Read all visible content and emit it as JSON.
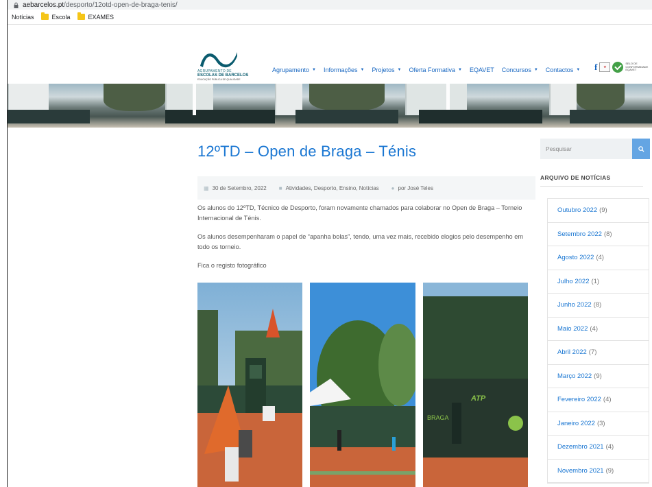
{
  "browser": {
    "url_host": "aebarcelos.pt",
    "url_path": "/desporto/12otd-open-de-braga-tenis/",
    "bookmarks": [
      "Notícias",
      "Escola",
      "EXAMES"
    ]
  },
  "logo": {
    "line1": "AGRUPAMENTO DE",
    "line2": "ESCOLAS DE BARCELOS",
    "line3": "EDUCAÇÃO PÚBLICA DE QUALIDADE"
  },
  "nav": [
    {
      "label": "Agrupamento",
      "dropdown": true
    },
    {
      "label": "Informações",
      "dropdown": true
    },
    {
      "label": "Projetos",
      "dropdown": true
    },
    {
      "label": "Oferta Formativa",
      "dropdown": true
    },
    {
      "label": "EQAVET",
      "dropdown": false
    },
    {
      "label": "Concursos",
      "dropdown": true
    },
    {
      "label": "Contactos",
      "dropdown": true
    }
  ],
  "social": {
    "facebook": "f",
    "seal_text": "SELO DE CONFORMIDADE EQAVET"
  },
  "post": {
    "title": "12ºTD – Open de Braga – Ténis",
    "date": "30 de Setembro, 2022",
    "categories": "Atividades, Desporto, Ensino, Notícias",
    "author": "por José Teles",
    "paragraphs": [
      "Os alunos do 12ºTD, Técnico de Desporto, foram novamente chamados para colaborar no Open de Braga – Torneio Internacional de Ténis.",
      "Os alunos desempenharam o papel de “apanha bolas”, tendo, uma vez mais, recebido elogios pelo desempenho em todo os torneio.",
      "Fica o registo fotográfico"
    ]
  },
  "sidebar": {
    "search_placeholder": "Pesquisar",
    "archive_title": "ARQUIVO DE NOTÍCIAS",
    "archive": [
      {
        "month": "Outubro 2022",
        "count": "(9)"
      },
      {
        "month": "Setembro 2022",
        "count": "(8)"
      },
      {
        "month": "Agosto 2022",
        "count": "(4)"
      },
      {
        "month": "Julho 2022",
        "count": "(1)"
      },
      {
        "month": "Junho 2022",
        "count": "(8)"
      },
      {
        "month": "Maio 2022",
        "count": "(4)"
      },
      {
        "month": "Abril 2022",
        "count": "(7)"
      },
      {
        "month": "Março 2022",
        "count": "(9)"
      },
      {
        "month": "Fevereiro 2022",
        "count": "(4)"
      },
      {
        "month": "Janeiro 2022",
        "count": "(3)"
      },
      {
        "month": "Dezembro 2021",
        "count": "(4)"
      },
      {
        "month": "Novembro 2021",
        "count": "(9)"
      }
    ]
  },
  "colors": {
    "link": "#1976d2",
    "search_button": "#64a5e3",
    "clay": "#c9653a"
  }
}
